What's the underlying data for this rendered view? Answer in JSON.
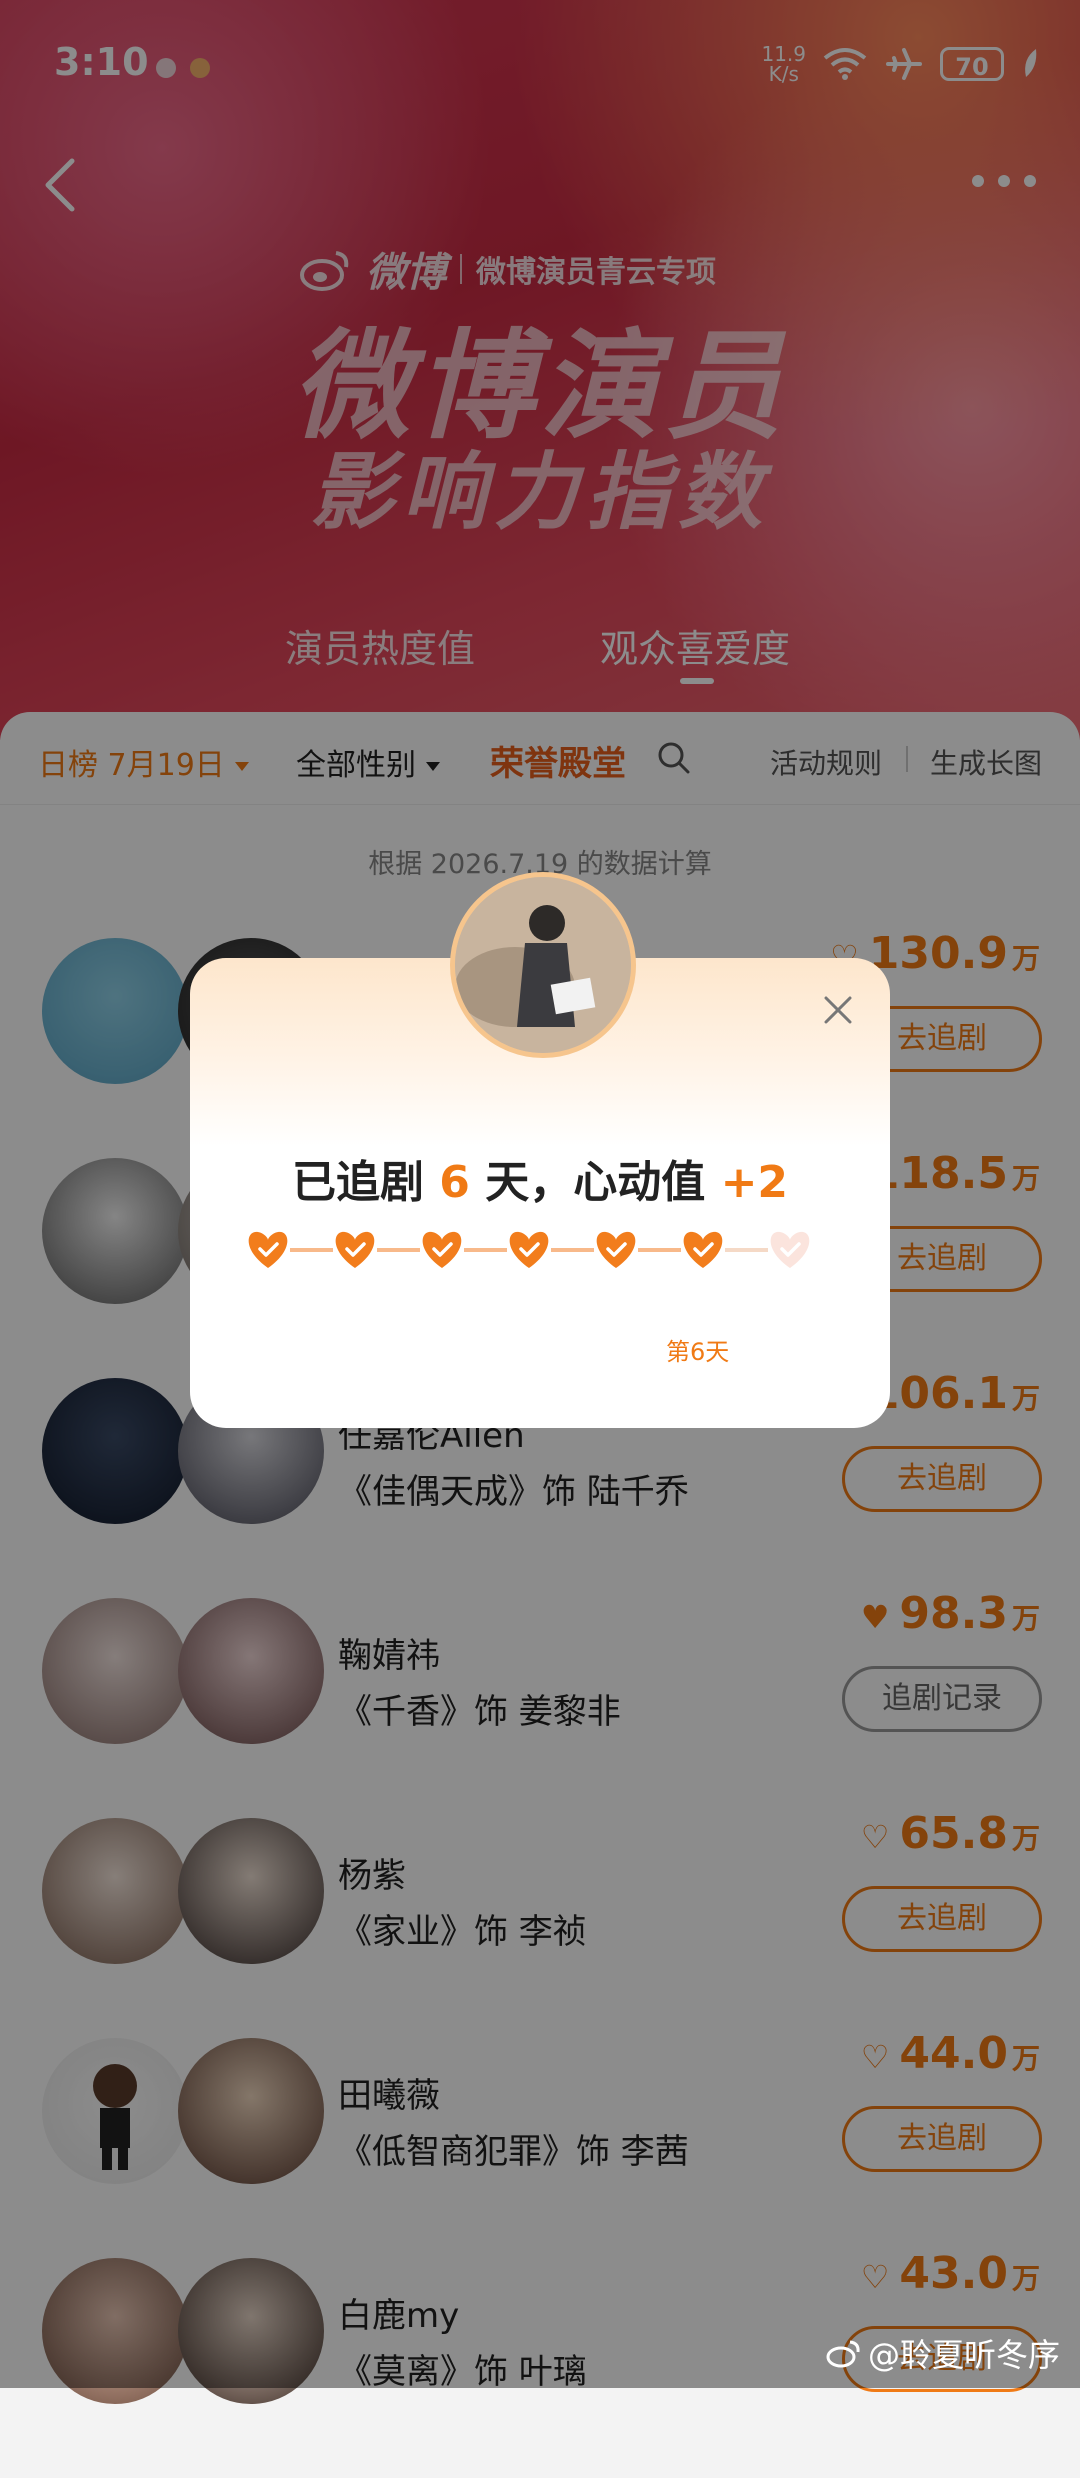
{
  "status_bar": {
    "time": "3:10",
    "net_speed_value": "11.9",
    "net_speed_unit": "K/s",
    "battery": "70"
  },
  "header": {
    "brand": "微博",
    "brand_sub": "微博演员青云专项",
    "title_line1": "微博演员",
    "title_line2": "影响力指数",
    "tabs": [
      {
        "label": "演员热度值",
        "active": false
      },
      {
        "label": "观众喜爱度",
        "active": true
      }
    ]
  },
  "filters": {
    "date": "日榜 7月19日",
    "gender": "全部性别",
    "hall": "荣誉殿堂",
    "rules": "活动规则",
    "long_image": "生成长图"
  },
  "calc_note": "根据 2026.7.19 的数据计算",
  "rows": [
    {
      "name": "",
      "role": "",
      "score": "130.9",
      "unit": "万",
      "button": "去追剧",
      "followed": false
    },
    {
      "name": "",
      "role": "",
      "score": "118.5",
      "unit": "万",
      "button": "去追剧",
      "followed": false
    },
    {
      "name": "任嘉伦Allen",
      "role": "《佳偶天成》饰 陆千乔",
      "score": "106.1",
      "unit": "万",
      "button": "去追剧",
      "followed": false
    },
    {
      "name": "鞠婧祎",
      "role": "《千香》饰 姜黎非",
      "score": "98.3",
      "unit": "万",
      "button": "追剧记录",
      "followed": true
    },
    {
      "name": "杨紫",
      "role": "《家业》饰 李祯",
      "score": "65.8",
      "unit": "万",
      "button": "去追剧",
      "followed": false
    },
    {
      "name": "田曦薇",
      "role": "《低智商犯罪》饰 李茜",
      "score": "44.0",
      "unit": "万",
      "button": "去追剧",
      "followed": false
    },
    {
      "name": "白鹿my",
      "role": "《莫离》饰 叶璃",
      "score": "43.0",
      "unit": "万",
      "button": "去追剧",
      "followed": false
    }
  ],
  "popup": {
    "prefix": "已追剧",
    "days": "6",
    "mid": "天，心动值",
    "bonus": "+2",
    "progress_days_filled": 6,
    "progress_days_total": 7,
    "current_day_label": "第6天"
  },
  "watermark": "@聆夏听冬序",
  "colors": {
    "accent": "#f07a15",
    "hero_red": "#c92b43"
  }
}
